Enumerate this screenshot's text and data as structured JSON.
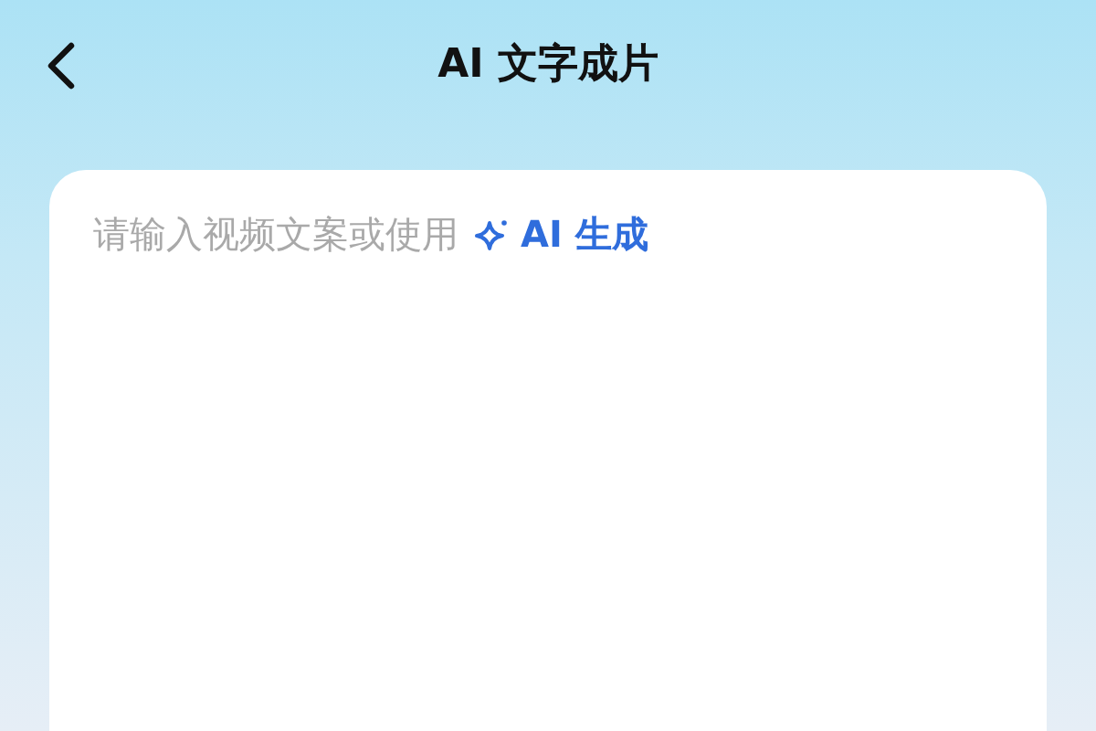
{
  "header": {
    "title": "AI 文字成片"
  },
  "editor": {
    "placeholder": "请输入视频文案或使用",
    "ai_button": {
      "label": "AI 生成"
    }
  }
}
